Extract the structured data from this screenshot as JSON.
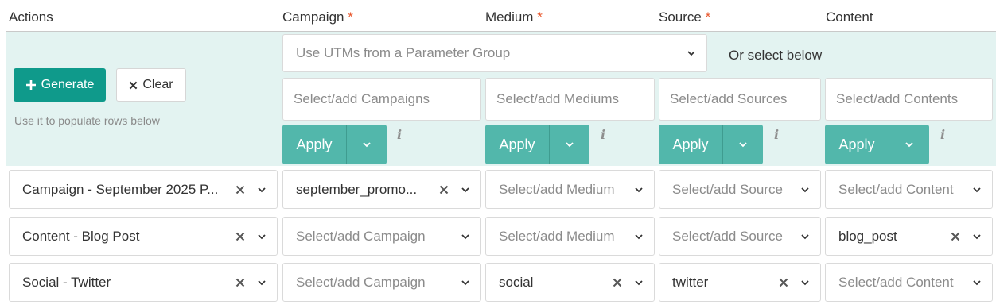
{
  "headers": {
    "actions": "Actions",
    "campaign": "Campaign",
    "medium": "Medium",
    "source": "Source",
    "content": "Content",
    "required_mark": "*"
  },
  "toolbar": {
    "generate_label": "Generate",
    "clear_label": "Clear",
    "hint": "Use it to populate rows below",
    "param_group_placeholder": "Use UTMs from a Parameter Group",
    "or_select": "Or select below",
    "apply_label": "Apply",
    "info_glyph": "i"
  },
  "selectors": {
    "campaigns": "Select/add Campaigns",
    "mediums": "Select/add Mediums",
    "sources": "Select/add Sources",
    "contents": "Select/add Contents"
  },
  "rows": [
    {
      "action": "Campaign - September 2025 P...",
      "campaign": "september_promo...",
      "medium": "Select/add Medium",
      "source": "Select/add Source",
      "content": "Select/add Content"
    },
    {
      "action": "Content - Blog Post",
      "campaign": "Select/add Campaign",
      "medium": "Select/add Medium",
      "source": "Select/add Source",
      "content": "blog_post"
    },
    {
      "action": "Social - Twitter",
      "campaign": "Select/add Campaign",
      "medium": "social",
      "source": "twitter",
      "content": "Select/add Content"
    }
  ],
  "colors": {
    "primary": "#0f9a8b",
    "apply": "#52b7ab",
    "panel": "#e3f3f1",
    "required": "#e8552a"
  }
}
